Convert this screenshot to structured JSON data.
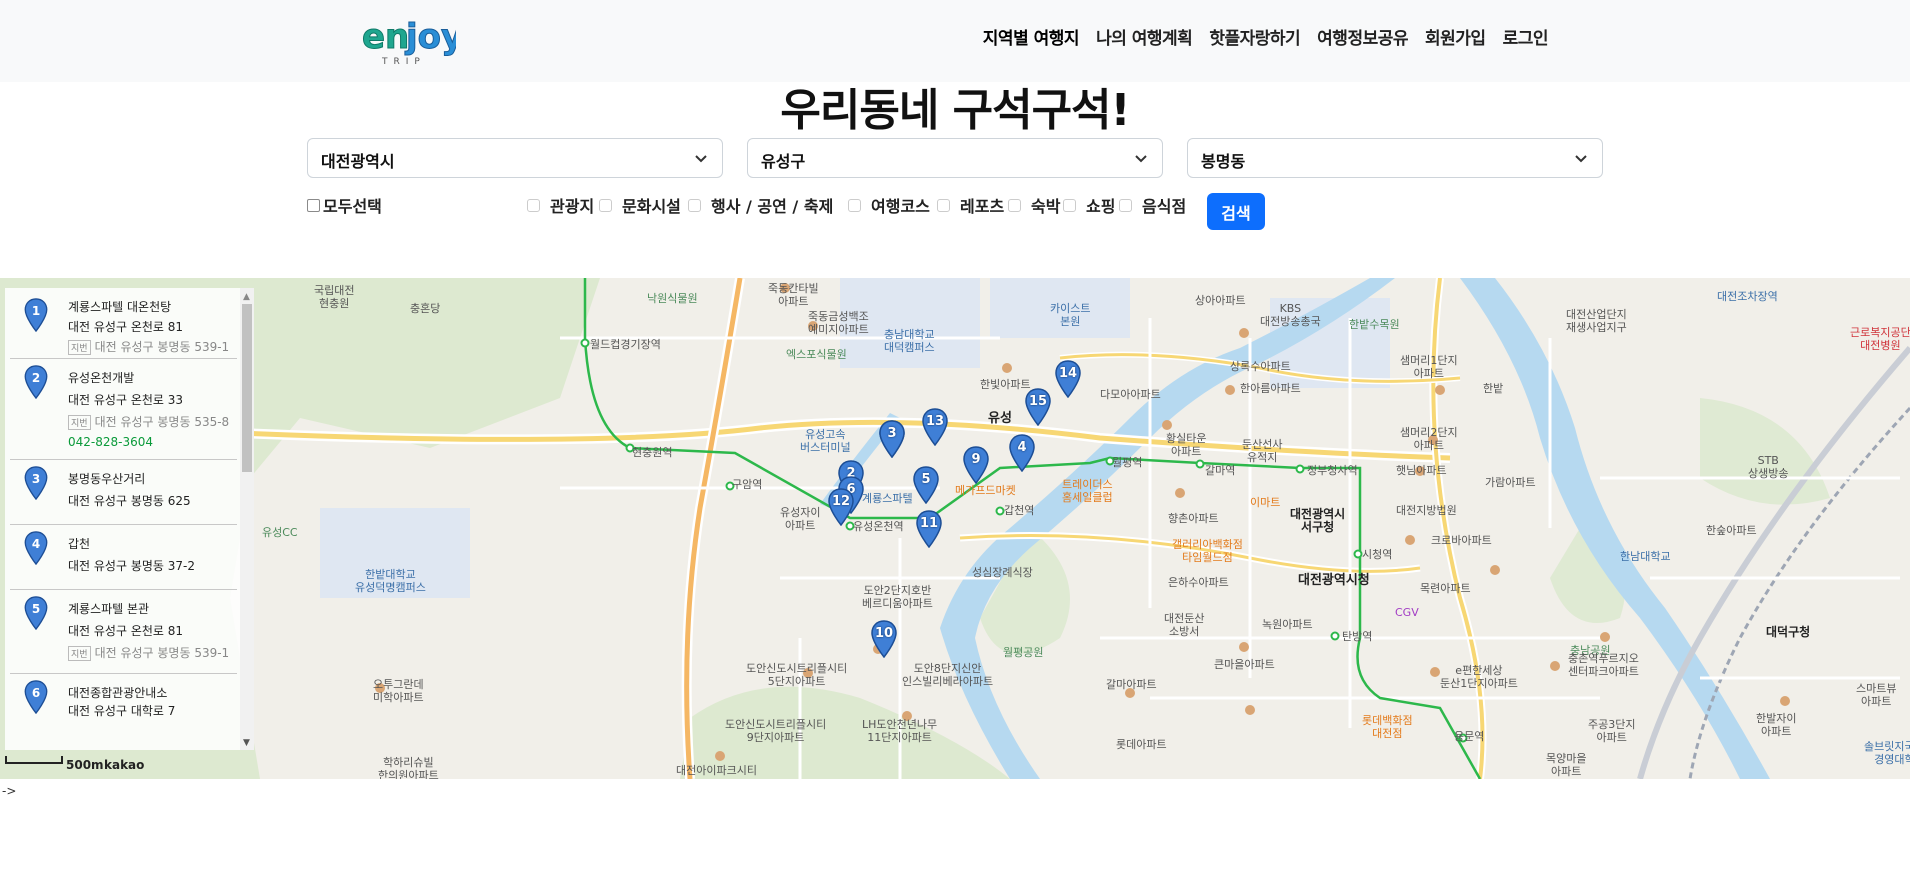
{
  "header": {
    "logo_text": "enjoy",
    "logo_subtext": "TRIP",
    "nav": [
      "지역별 여행지",
      "나의 여행계획",
      "핫플자랑하기",
      "여행정보공유",
      "회원가입",
      "로그인"
    ]
  },
  "page_title": "우리동네 구석구석!",
  "filters": {
    "sido": "대전광역시",
    "gugun": "유성구",
    "dong": "봉명동",
    "select_all": "모두선택",
    "categories": [
      "관광지",
      "문화시설",
      "행사 / 공연 / 축제",
      "여행코스",
      "레포츠",
      "숙박",
      "쇼핑",
      "음식점"
    ],
    "search_button": "검색"
  },
  "results": [
    {
      "num": "1",
      "title": "계룡스파텔 대온천탕",
      "road": "대전 유성구 온천로 81",
      "jibun_tag": "지번",
      "jibun": "대전 유성구 봉명동 539-1",
      "tel": ""
    },
    {
      "num": "2",
      "title": "유성온천개발",
      "road": "대전 유성구 온천로 33",
      "jibun_tag": "지번",
      "jibun": "대전 유성구 봉명동 535-8",
      "tel": "042-828-3604"
    },
    {
      "num": "3",
      "title": "봉명동우산거리",
      "road": "대전 유성구 봉명동 625",
      "jibun_tag": "",
      "jibun": "",
      "tel": ""
    },
    {
      "num": "4",
      "title": "갑천",
      "road": "대전 유성구 봉명동 37-2",
      "jibun_tag": "",
      "jibun": "",
      "tel": ""
    },
    {
      "num": "5",
      "title": "계룡스파텔 본관",
      "road": "대전 유성구 온천로 81",
      "jibun_tag": "지번",
      "jibun": "대전 유성구 봉명동 539-1",
      "tel": ""
    },
    {
      "num": "6",
      "title": "대전종합관광안내소",
      "road": "대전 유성구 대학로 7",
      "jibun_tag": "",
      "jibun": "",
      "tel": ""
    }
  ],
  "map": {
    "scale": "500m",
    "provider": "kakao",
    "markers": [
      "1",
      "2",
      "3",
      "4",
      "5",
      "6",
      "9",
      "10",
      "11",
      "12",
      "13",
      "14",
      "15"
    ],
    "labels": {
      "l1": "국립대전\n현충원",
      "l2": "충혼당",
      "l3": "낙원식물원",
      "l4": "죽동칸타빌\n아파트",
      "l5": "죽동금성백조\n예미지아파트",
      "l6": "충남대학교\n대덕캠퍼스",
      "l7": "카이스트\n본원",
      "l8": "상아아파트",
      "l9": "KBS\n대전방송총국",
      "l10": "한밭수목원",
      "l11": "대전산업단지\n재생사업지구",
      "l12": "대전조차장역",
      "l13": "근로복지공단\n대전병원",
      "l14": "월드컵경기장역",
      "l15": "엑스포식물원",
      "l16": "한빛아파트",
      "l17": "유성",
      "l18": "다모아아파트",
      "l19": "상록수아파트",
      "l20": "한아름아파트",
      "l21": "샘머리1단지\n아파트",
      "l22": "한밭",
      "l23": "현충원역",
      "l24": "유성고속\n버스터미널",
      "l25": "월평역",
      "l26": "황실타운\n아파트",
      "l27": "둔산선사\n유적지",
      "l28": "샘머리2단지\n아파트",
      "l29": "STB\n상생방송",
      "l30": "구암역",
      "l31": "갑천역",
      "l32": "트레이더스\n홈세일클럽",
      "l33": "갈마역",
      "l34": "정부청사역",
      "l35": "햇님아파트",
      "l36": "가람아파트",
      "l37": "유성CC",
      "l38": "유성자이\n아파트",
      "l39": "유성온천역",
      "l40": "계룡스파텔",
      "l41": "향촌아파트",
      "l42": "이마트",
      "l43": "대전광역시\n서구청",
      "l44": "대전지방법원",
      "l45": "한숲아파트",
      "l46": "한밭대학교\n유성덕명캠퍼스",
      "l47": "성심장례식장",
      "l48": "갤러리아백화점\n타임월드점",
      "l49": "시청역",
      "l50": "크로바아파트",
      "l51": "한남대학교",
      "l52": "도안2단지호반\n베르디움아파트",
      "l53": "은하수아파트",
      "l54": "대전광역시청",
      "l55": "목련아파트",
      "l56": "CGV",
      "l57": "대전둔산\n소방서",
      "l58": "녹원아파트",
      "l59": "탄방역",
      "l60": "대덕구청",
      "l61": "월평공원",
      "l62": "큰마을아파트",
      "l63": "도안신도시트리플시티\n5단지아파트",
      "l64": "도안8단지신안\n인스빌리베라아파트",
      "l65": "오투그란데\n미학아파트",
      "l66": "갈마아파트",
      "l67": "e편한세상\n둔산1단지아파트",
      "l68": "충남공원",
      "l69": "충촌역푸르지오\n센터파크아파트",
      "l70": "스마트뷰\n아파트",
      "l71": "도안신도시트리플시티\n9단지아파트",
      "l72": "LH도안천년나무\n11단지아파트",
      "l73": "롯데백화점\n대전점",
      "l74": "용문역",
      "l75": "주공3단지\n아파트",
      "l76": "한발자이\n아파트",
      "l77": "학하리슈빌\n한의원아파트",
      "l78": "대전아이파크시티",
      "l79": "롯데아파트",
      "l80": "목양마을\n아파트",
      "l81": "솔브릿지국제\n경영대학",
      "l82": "메가프드마켓"
    }
  },
  "stray_text": "->"
}
